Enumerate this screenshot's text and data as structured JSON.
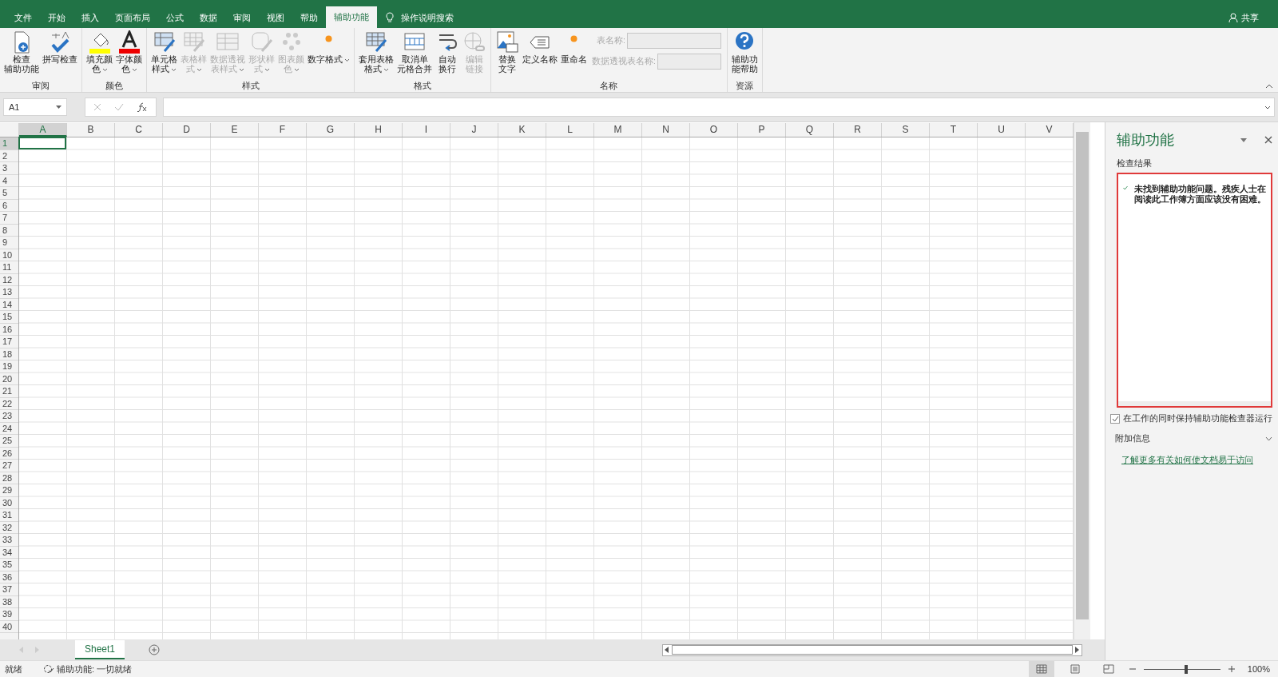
{
  "tabs": [
    {
      "label": "文件",
      "selected": false
    },
    {
      "label": "开始",
      "selected": false
    },
    {
      "label": "插入",
      "selected": false
    },
    {
      "label": "页面布局",
      "selected": false
    },
    {
      "label": "公式",
      "selected": false
    },
    {
      "label": "数据",
      "selected": false
    },
    {
      "label": "审阅",
      "selected": false
    },
    {
      "label": "视图",
      "selected": false
    },
    {
      "label": "帮助",
      "selected": false
    },
    {
      "label": "辅助功能",
      "selected": true
    }
  ],
  "tell_me": {
    "placeholder": "操作说明搜索"
  },
  "share": {
    "label": "共享"
  },
  "ribbon_groups": [
    {
      "label": "审阅",
      "buttons": [
        {
          "lines": [
            "检查",
            "辅助功能"
          ],
          "disabled": false,
          "has_menu": false
        },
        {
          "lines": [
            "拼写检查"
          ],
          "disabled": false,
          "has_menu": false
        }
      ]
    },
    {
      "label": "颜色",
      "buttons": [
        {
          "lines": [
            "填充颜",
            "色"
          ],
          "disabled": false,
          "has_menu": true
        },
        {
          "lines": [
            "字体颜",
            "色"
          ],
          "disabled": false,
          "has_menu": true
        }
      ]
    },
    {
      "label": "样式",
      "buttons": [
        {
          "lines": [
            "单元格",
            "样式"
          ],
          "disabled": false,
          "has_menu": true
        },
        {
          "lines": [
            "表格样",
            "式"
          ],
          "disabled": true,
          "has_menu": true
        },
        {
          "lines": [
            "数据透视",
            "表样式"
          ],
          "disabled": true,
          "has_menu": true
        },
        {
          "lines": [
            "形状样",
            "式"
          ],
          "disabled": true,
          "has_menu": true
        },
        {
          "lines": [
            "图表颜",
            "色"
          ],
          "disabled": true,
          "has_menu": true
        },
        {
          "lines": [
            "数字格式"
          ],
          "disabled": false,
          "has_menu": true
        }
      ]
    },
    {
      "label": "格式",
      "buttons": [
        {
          "lines": [
            "套用表格",
            "格式"
          ],
          "disabled": false,
          "has_menu": true
        },
        {
          "lines": [
            "取消单",
            "元格合并"
          ],
          "disabled": false,
          "has_menu": false
        },
        {
          "lines": [
            "自动",
            "换行"
          ],
          "disabled": false,
          "has_menu": false
        },
        {
          "lines": [
            "编辑",
            "链接"
          ],
          "disabled": true,
          "has_menu": false
        }
      ]
    },
    {
      "label": "名称",
      "buttons": [
        {
          "lines": [
            "替换",
            "文字"
          ],
          "disabled": false,
          "has_menu": false
        },
        {
          "lines": [
            "定义名称"
          ],
          "disabled": false,
          "has_menu": false
        },
        {
          "lines": [
            "重命名"
          ],
          "disabled": false,
          "has_menu": false
        }
      ],
      "fields": [
        {
          "label": "表名称:",
          "disabled": true
        },
        {
          "label": "数据透视表名称:",
          "disabled": true
        }
      ]
    },
    {
      "label": "资源",
      "buttons": [
        {
          "lines": [
            "辅助功",
            "能帮助"
          ],
          "disabled": false,
          "has_menu": false
        }
      ]
    }
  ],
  "name_box": {
    "value": "A1"
  },
  "columns": [
    {
      "label": "A",
      "selected": true
    },
    {
      "label": "B",
      "selected": false
    },
    {
      "label": "C",
      "selected": false
    },
    {
      "label": "D",
      "selected": false
    },
    {
      "label": "E",
      "selected": false
    },
    {
      "label": "F",
      "selected": false
    },
    {
      "label": "G",
      "selected": false
    },
    {
      "label": "H",
      "selected": false
    },
    {
      "label": "I",
      "selected": false
    },
    {
      "label": "J",
      "selected": false
    },
    {
      "label": "K",
      "selected": false
    },
    {
      "label": "L",
      "selected": false
    },
    {
      "label": "M",
      "selected": false
    },
    {
      "label": "N",
      "selected": false
    },
    {
      "label": "O",
      "selected": false
    },
    {
      "label": "P",
      "selected": false
    },
    {
      "label": "Q",
      "selected": false
    },
    {
      "label": "R",
      "selected": false
    },
    {
      "label": "S",
      "selected": false
    },
    {
      "label": "T",
      "selected": false
    },
    {
      "label": "U",
      "selected": false
    },
    {
      "label": "V",
      "selected": false
    }
  ],
  "rows": [
    {
      "label": "1",
      "selected": true
    },
    {
      "label": "2",
      "selected": false
    },
    {
      "label": "3",
      "selected": false
    },
    {
      "label": "4",
      "selected": false
    },
    {
      "label": "5",
      "selected": false
    },
    {
      "label": "6",
      "selected": false
    },
    {
      "label": "7",
      "selected": false
    },
    {
      "label": "8",
      "selected": false
    },
    {
      "label": "9",
      "selected": false
    },
    {
      "label": "10",
      "selected": false
    },
    {
      "label": "11",
      "selected": false
    },
    {
      "label": "12",
      "selected": false
    },
    {
      "label": "13",
      "selected": false
    },
    {
      "label": "14",
      "selected": false
    },
    {
      "label": "15",
      "selected": false
    },
    {
      "label": "16",
      "selected": false
    },
    {
      "label": "17",
      "selected": false
    },
    {
      "label": "18",
      "selected": false
    },
    {
      "label": "19",
      "selected": false
    },
    {
      "label": "20",
      "selected": false
    },
    {
      "label": "21",
      "selected": false
    },
    {
      "label": "22",
      "selected": false
    },
    {
      "label": "23",
      "selected": false
    },
    {
      "label": "24",
      "selected": false
    },
    {
      "label": "25",
      "selected": false
    },
    {
      "label": "26",
      "selected": false
    },
    {
      "label": "27",
      "selected": false
    },
    {
      "label": "28",
      "selected": false
    },
    {
      "label": "29",
      "selected": false
    },
    {
      "label": "30",
      "selected": false
    },
    {
      "label": "31",
      "selected": false
    },
    {
      "label": "32",
      "selected": false
    },
    {
      "label": "33",
      "selected": false
    },
    {
      "label": "34",
      "selected": false
    },
    {
      "label": "35",
      "selected": false
    },
    {
      "label": "36",
      "selected": false
    },
    {
      "label": "37",
      "selected": false
    },
    {
      "label": "38",
      "selected": false
    },
    {
      "label": "39",
      "selected": false
    },
    {
      "label": "40",
      "selected": false
    }
  ],
  "sheets": [
    {
      "label": "Sheet1",
      "selected": true
    }
  ],
  "pane": {
    "title": "辅助功能",
    "section": "检查结果",
    "result": "未找到辅助功能问题。残疾人士在阅读此工作簿方面应该没有困难。",
    "keep_running": {
      "label": "在工作的同时保持辅助功能检查器运行",
      "checked": true
    },
    "more_info": {
      "label": "附加信息",
      "expanded": false
    },
    "link": "了解更多有关如何使文档易于访问"
  },
  "status": {
    "ready": "就绪",
    "accessibility": "辅助功能: 一切就绪",
    "views": [
      {
        "selected": true
      },
      {
        "selected": false
      },
      {
        "selected": false
      }
    ],
    "zoom": {
      "level": 0.55,
      "text": "100%"
    }
  }
}
